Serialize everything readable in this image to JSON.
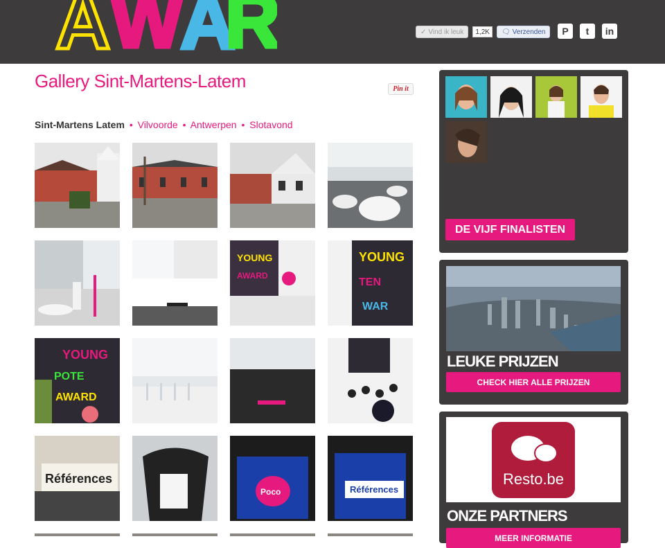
{
  "header": {
    "fb_like": "Vind ik leuk",
    "fb_count": "1,2K",
    "fb_send": "Verzenden",
    "share": [
      {
        "icon": "pinterest-icon",
        "glyph": "P"
      },
      {
        "icon": "twitter-icon",
        "glyph": "t"
      },
      {
        "icon": "linkedin-icon",
        "glyph": "in"
      }
    ]
  },
  "main": {
    "title": "Gallery Sint-Martens-Latem",
    "pinit": "Pin it",
    "nav": {
      "current": "Sint-Martens Latem",
      "separator": "•",
      "links": [
        "Vilvoorde",
        "Antwerpen",
        "Slotavond"
      ]
    }
  },
  "sidebar": {
    "finalists_button": "DE VIJF FINALISTEN",
    "prizes_heading": "LEUKE PRIJZEN",
    "prizes_button": "CHECK HIER ALLE PRIJZEN",
    "partner_logo_text": "Resto.be",
    "partners_heading": "ONZE PARTNERS",
    "partners_button": "MEER INFORMATIE"
  },
  "colors": {
    "accent": "#e6197e",
    "header_bg": "#3e3b3c",
    "sidebar_bg": "#3e3b3c",
    "resto_red": "#b01c3b"
  }
}
